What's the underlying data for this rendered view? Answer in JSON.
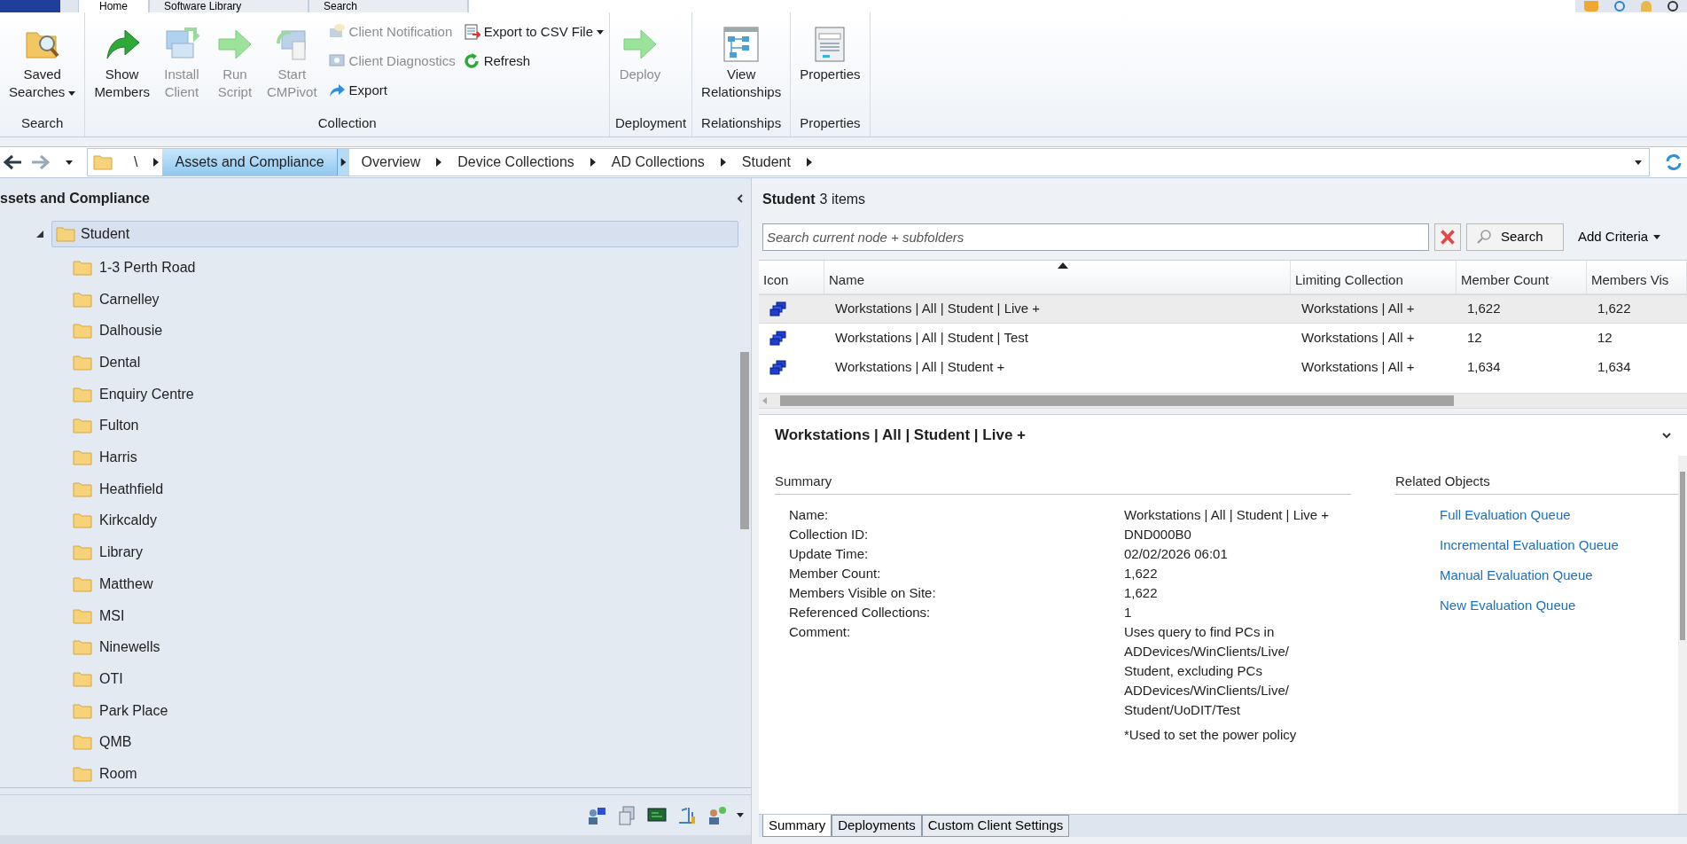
{
  "app_tabs": [
    {
      "label": "Home",
      "selected": true
    },
    {
      "label": "Software Library",
      "selected": false
    },
    {
      "label": "Search",
      "selected": false
    }
  ],
  "ribbon": [
    {
      "label": "Search",
      "large": [
        {
          "label": "Saved\nSearches",
          "dropdown": true,
          "disabled": false
        }
      ]
    },
    {
      "label": "Collection",
      "large": [
        {
          "label": "Show\nMembers",
          "dropdown": false,
          "disabled": false
        },
        {
          "label": "Install\nClient",
          "dropdown": false,
          "disabled": true
        },
        {
          "label": "Run\nScript",
          "dropdown": false,
          "disabled": true
        },
        {
          "label": "Start\nCMPivot",
          "dropdown": false,
          "disabled": true
        }
      ],
      "small_columns": [
        [
          {
            "label": "Client Notification",
            "dropdown": false,
            "disabled": true
          },
          {
            "label": "Client Diagnostics",
            "dropdown": false,
            "disabled": true
          },
          {
            "label": "Export",
            "dropdown": false,
            "disabled": false
          }
        ],
        [
          {
            "label": "Export to CSV File",
            "dropdown": true,
            "disabled": false
          },
          {
            "label": "Refresh",
            "dropdown": false,
            "disabled": false
          }
        ]
      ]
    },
    {
      "label": "Deployment",
      "large": [
        {
          "label": "Deploy",
          "dropdown": false,
          "disabled": true
        }
      ]
    },
    {
      "label": "Relationships",
      "large": [
        {
          "label": "View\nRelationships",
          "dropdown": false,
          "disabled": false
        }
      ]
    },
    {
      "label": "Properties",
      "large": [
        {
          "label": "Properties",
          "dropdown": false,
          "disabled": false
        }
      ]
    }
  ],
  "breadcrumb": [
    {
      "label": "\\",
      "selected": false
    },
    {
      "label": "Assets and Compliance",
      "selected": true
    },
    {
      "label": "Overview",
      "selected": false
    },
    {
      "label": "Device Collections",
      "selected": false
    },
    {
      "label": "AD Collections",
      "selected": false
    },
    {
      "label": "Student",
      "selected": false
    }
  ],
  "navigation": {
    "title": "ssets and Compliance",
    "tree": [
      {
        "label": "Student",
        "expanded": true,
        "selected": true,
        "children": [
          {
            "label": "1-3 Perth Road",
            "selected": false
          },
          {
            "label": "Carnelley",
            "selected": false
          },
          {
            "label": "Dalhousie",
            "selected": false
          },
          {
            "label": "Dental",
            "selected": false
          },
          {
            "label": "Enquiry Centre",
            "selected": false
          },
          {
            "label": "Fulton",
            "selected": false
          },
          {
            "label": "Harris",
            "selected": false
          },
          {
            "label": "Heathfield",
            "selected": false
          },
          {
            "label": "Kirkcaldy",
            "selected": false
          },
          {
            "label": "Library",
            "selected": false
          },
          {
            "label": "Matthew",
            "selected": false
          },
          {
            "label": "MSI",
            "selected": false
          },
          {
            "label": "Ninewells",
            "selected": false
          },
          {
            "label": "OTI",
            "selected": false
          },
          {
            "label": "Park Place",
            "selected": false
          },
          {
            "label": "QMB",
            "selected": false
          },
          {
            "label": "Room",
            "selected": false
          }
        ]
      }
    ]
  },
  "list": {
    "title": "Student",
    "count": "3 items",
    "search": {
      "placeholder": "Search current node + subfolders",
      "button": "Search",
      "add_criteria": "Add Criteria"
    },
    "columns": [
      {
        "label": "Icon",
        "sorted": false
      },
      {
        "label": "Name",
        "sorted": true
      },
      {
        "label": "Limiting Collection",
        "sorted": false
      },
      {
        "label": "Member Count",
        "sorted": false
      },
      {
        "label": "Members Vis",
        "sorted": false
      }
    ],
    "rows": [
      {
        "selected": true,
        "cells": [
          "",
          "Workstations | All | Student | Live +",
          "Workstations | All +",
          "1,622",
          "1,622"
        ]
      },
      {
        "selected": false,
        "cells": [
          "",
          "Workstations | All | Student | Test",
          "Workstations | All +",
          "12",
          "12"
        ]
      },
      {
        "selected": false,
        "cells": [
          "",
          "Workstations | All | Student +",
          "Workstations | All +",
          "1,634",
          "1,634"
        ]
      }
    ]
  },
  "details": {
    "title": "Workstations | All | Student | Live +",
    "summary": {
      "heading": "Summary",
      "fields": [
        {
          "label": "Name:",
          "value": "Workstations | All | Student | Live +"
        },
        {
          "label": "Collection ID:",
          "value": "DND000B0"
        },
        {
          "label": "Update Time:",
          "value": "02/02/2026 06:01"
        },
        {
          "label": "Member Count:",
          "value": "1,622"
        },
        {
          "label": "Members Visible on Site:",
          "value": "1,622"
        },
        {
          "label": "Referenced Collections:",
          "value": "1"
        },
        {
          "label": "Comment:",
          "value": "Uses query to find PCs in\nADDevices/WinClients/Live/\nStudent, excluding PCs\nADDevices/WinClients/Live/\nStudent/UoDIT/Test",
          "note": "*Used to set the power policy"
        }
      ]
    },
    "related": {
      "heading": "Related Objects",
      "links": [
        "Full Evaluation Queue",
        "Incremental Evaluation Queue",
        "Manual Evaluation Queue",
        "New Evaluation Queue"
      ]
    }
  },
  "detail_tabs": [
    {
      "label": "Summary",
      "selected": true
    },
    {
      "label": "Deployments",
      "selected": false
    },
    {
      "label": "Custom Client Settings",
      "selected": false
    }
  ]
}
